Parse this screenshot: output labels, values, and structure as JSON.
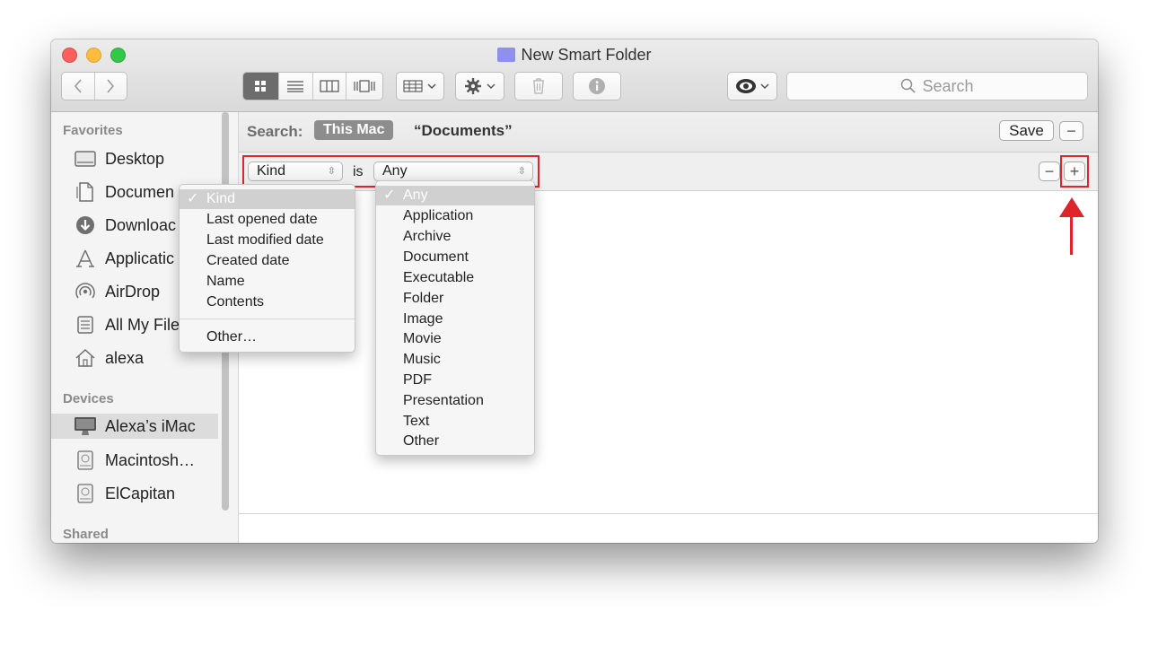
{
  "window": {
    "title": "New Smart Folder",
    "colors": {
      "accent_red": "#e0252a",
      "close": "#fc605c",
      "minimize": "#fdbc40",
      "zoom": "#34c84a"
    }
  },
  "toolbar": {
    "back_icon": "chevron-left-icon",
    "forward_icon": "chevron-right-icon",
    "view_icons": [
      "icon-view-icon",
      "list-view-icon",
      "column-view-icon",
      "cover-flow-icon"
    ],
    "arrange_icon": "arrange-grid-icon",
    "action_icon": "gear-icon",
    "trash_icon": "trash-icon",
    "info_icon": "info-icon",
    "quicklook_icon": "eye-icon",
    "search_placeholder": "Search"
  },
  "sidebar": {
    "favorites_header": "Favorites",
    "favorites": [
      {
        "label": "Desktop",
        "icon": "desktop-icon"
      },
      {
        "label": "Documen",
        "icon": "documents-icon"
      },
      {
        "label": "Downloac",
        "icon": "downloads-icon"
      },
      {
        "label": "Applicatic",
        "icon": "applications-icon"
      },
      {
        "label": "AirDrop",
        "icon": "airdrop-icon"
      },
      {
        "label": "All My File",
        "icon": "all-files-icon"
      },
      {
        "label": "alexa",
        "icon": "home-icon"
      }
    ],
    "devices_header": "Devices",
    "devices": [
      {
        "label": "Alexa’s iMac",
        "icon": "imac-icon"
      },
      {
        "label": "Macintosh…",
        "icon": "disk-icon"
      },
      {
        "label": "ElCapitan",
        "icon": "disk-icon"
      }
    ],
    "shared_header": "Shared"
  },
  "searchbar": {
    "label": "Search:",
    "scope_selected": "This Mac",
    "scope_other": "“Documents”",
    "save_label": "Save",
    "minus_label": "−"
  },
  "criteria": {
    "attribute": "Kind",
    "operator": "is",
    "value": "Any",
    "minus_label": "−",
    "plus_label": "+"
  },
  "attribute_menu": {
    "checkmark": "✓",
    "items": [
      "Kind",
      "Last opened date",
      "Last modified date",
      "Created date",
      "Name",
      "Contents"
    ],
    "other": "Other…"
  },
  "kind_menu": {
    "checkmark": "✓",
    "items": [
      "Any",
      "Application",
      "Archive",
      "Document",
      "Executable",
      "Folder",
      "Image",
      "Movie",
      "Music",
      "PDF",
      "Presentation",
      "Text",
      "Other"
    ]
  }
}
